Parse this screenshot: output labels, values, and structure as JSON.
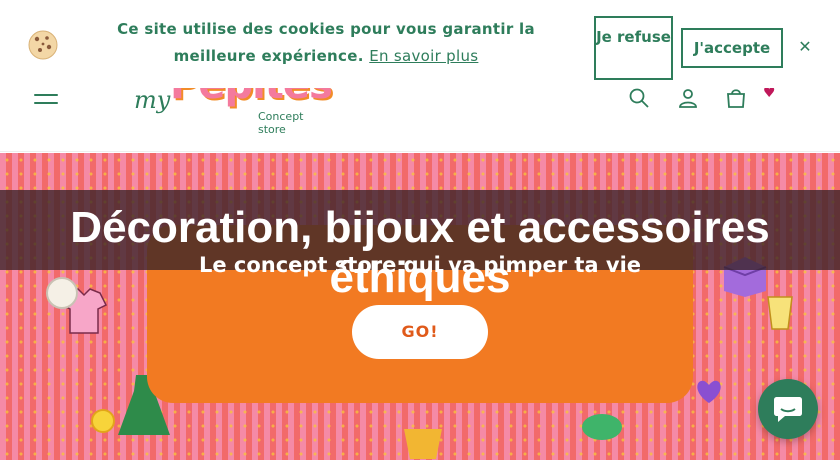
{
  "cookie_banner": {
    "message": "Ce site utilise des cookies pour vous garantir la meilleure expérience.",
    "learn_more": "En savoir plus",
    "refuse_label": "Je refuse",
    "accept_label": "J'accepte",
    "close_glyph": "✕",
    "icon": "cookie-icon"
  },
  "header": {
    "logo_prefix": "my",
    "logo_word": "Pépites",
    "logo_tagline": "Concept store",
    "icons": [
      "menu-icon",
      "search-icon",
      "account-icon",
      "cart-icon",
      "heart-icon"
    ]
  },
  "hero": {
    "title": "Décoration, bijoux et accessoires éthiques",
    "subtitle": "Le concept store qui va pimper ta vie",
    "cta_label": "GO!"
  },
  "chat": {
    "icon": "chat-icon"
  },
  "colors": {
    "brand_green": "#2e7d5b",
    "hero_orange": "#f27a22",
    "hero_pink": "#f58aa6",
    "hero_coral": "#f26a6a",
    "logo_pink": "#f47a9d"
  }
}
